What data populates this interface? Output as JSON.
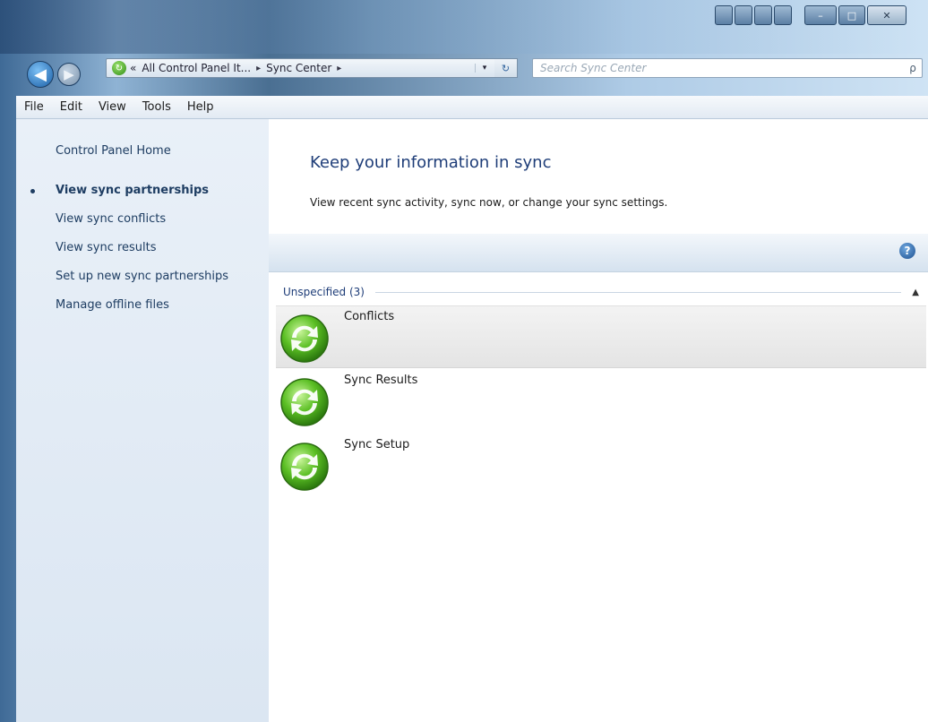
{
  "window": {
    "title_controls": {
      "minimize": "–",
      "maximize": "□",
      "close": "✕"
    }
  },
  "nav": {
    "back_icon": "back-arrow-icon",
    "forward_icon": "forward-arrow-icon"
  },
  "address": {
    "prefix": "«",
    "crumbs": [
      "All Control Panel It...",
      "Sync Center"
    ],
    "separator": "▸",
    "dropdown": "▾",
    "refresh": "↻"
  },
  "search": {
    "placeholder": "Search Sync Center",
    "icon": "ρ"
  },
  "menubar": {
    "items": [
      "File",
      "Edit",
      "View",
      "Tools",
      "Help"
    ]
  },
  "sidebar": {
    "home": "Control Panel Home",
    "items": [
      {
        "label": "View sync partnerships",
        "active": true
      },
      {
        "label": "View sync conflicts",
        "active": false
      },
      {
        "label": "View sync results",
        "active": false
      },
      {
        "label": "Set up new sync partnerships",
        "active": false
      },
      {
        "label": "Manage offline files",
        "active": false
      }
    ]
  },
  "main": {
    "title": "Keep your information in sync",
    "description": "View recent sync activity, sync now, or change your sync settings.",
    "help": "?",
    "group": {
      "label": "Unspecified (3)",
      "collapse": "▲"
    },
    "items": [
      {
        "label": "Conflicts",
        "selected": true
      },
      {
        "label": "Sync Results",
        "selected": false
      },
      {
        "label": "Sync Setup",
        "selected": false
      }
    ]
  },
  "colors": {
    "accent": "#1e3d78",
    "icon_green": "#5bbf24"
  }
}
